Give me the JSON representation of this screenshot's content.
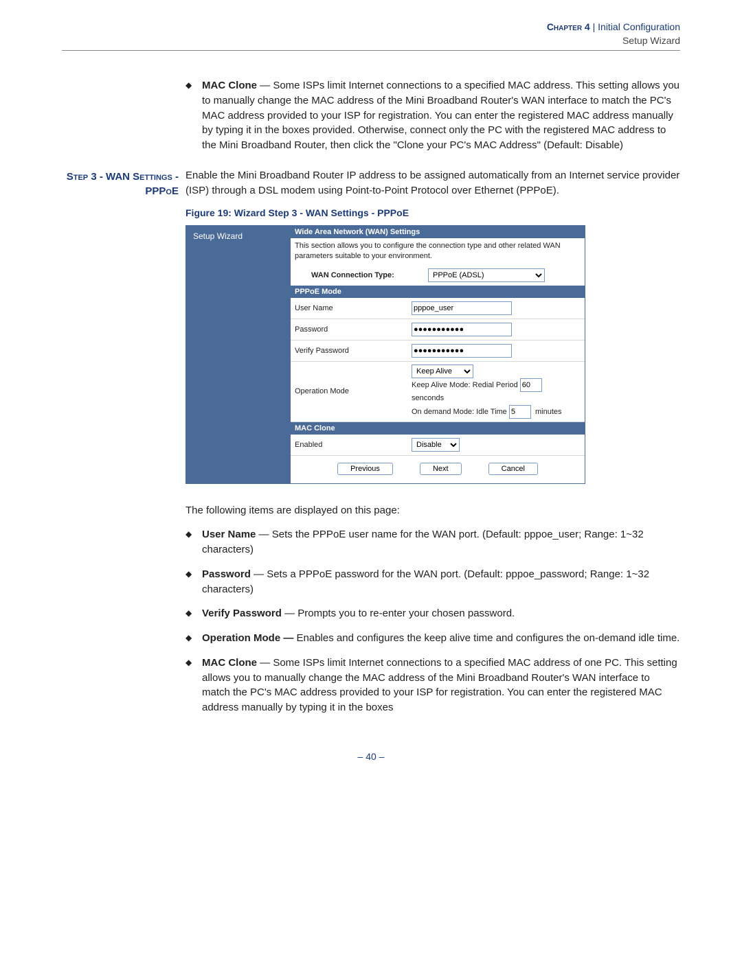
{
  "header": {
    "chapter": "Chapter 4",
    "sep": "|",
    "section": "Initial Configuration",
    "subsection": "Setup Wizard"
  },
  "macclone_top": {
    "term": "MAC Clone",
    "text": " — Some ISPs limit Internet connections to a specified MAC address. This setting allows you to manually change the MAC address of the Mini Broadband Router's WAN interface to match the PC's MAC address provided to your ISP for registration. You can enter the registered MAC address manually by typing it in the boxes provided. Otherwise, connect only the PC with the registered MAC address to the Mini Broadband Router, then click the \"Clone your PC's MAC Address\" (Default: Disable)"
  },
  "step_heading": "Step 3 - WAN Settings - PPPoE",
  "step_intro": "Enable the Mini Broadband Router IP address to be assigned automatically from an Internet service provider (ISP) through a DSL modem using Point-to-Point Protocol over Ethernet (PPPoE).",
  "figure_caption": "Figure 19:  Wizard Step 3 - WAN Settings - PPPoE",
  "router": {
    "side": "Setup Wizard",
    "band_wan": "Wide Area Network (WAN) Settings",
    "desc": "This section allows you to configure the connection type and other related WAN parameters suitable to your environment.",
    "wan_type_lbl": "WAN Connection Type:",
    "wan_type_val": "PPPoE (ADSL)",
    "band_pppoe": "PPPoE Mode",
    "user_lbl": "User Name",
    "user_val": "pppoe_user",
    "pass_lbl": "Password",
    "pass_val": "●●●●●●●●●●●",
    "vpass_lbl": "Verify Password",
    "vpass_val": "●●●●●●●●●●●",
    "opmode_lbl": "Operation Mode",
    "opmode_val": "Keep Alive",
    "keepalive_pre": "Keep Alive Mode: Redial Period ",
    "keepalive_val": "60",
    "keepalive_post": "senconds",
    "ondemand_pre": "On demand Mode: Idle Time ",
    "ondemand_val": "5",
    "ondemand_post": "minutes",
    "band_mac": "MAC Clone",
    "mac_enabled_lbl": "Enabled",
    "mac_enabled_val": "Disable",
    "btn_prev": "Previous",
    "btn_next": "Next",
    "btn_cancel": "Cancel"
  },
  "following": "The following items are displayed on this page:",
  "items": {
    "username": {
      "term": "User Name",
      "text": " — Sets the PPPoE user name for the WAN port. (Default: pppoe_user; Range: 1~32 characters)"
    },
    "password": {
      "term": "Password",
      "text": " — Sets a PPPoE password for the WAN port. (Default: pppoe_password; Range: 1~32 characters)"
    },
    "verify": {
      "term": "Verify Password",
      "text": " — Prompts you to re-enter your chosen password."
    },
    "opmode": {
      "term": "Operation Mode —",
      "text": " Enables and configures the keep alive time and configures the on-demand idle time."
    },
    "macclone": {
      "term": "MAC Clone",
      "text": " — Some ISPs limit Internet connections to a specified MAC address of one PC. This setting allows you to manually change the MAC address of the Mini Broadband Router's WAN interface to match the PC's MAC address provided to your ISP for registration. You can enter the registered MAC address manually by typing it in the boxes"
    }
  },
  "page_number": "–  40  –"
}
